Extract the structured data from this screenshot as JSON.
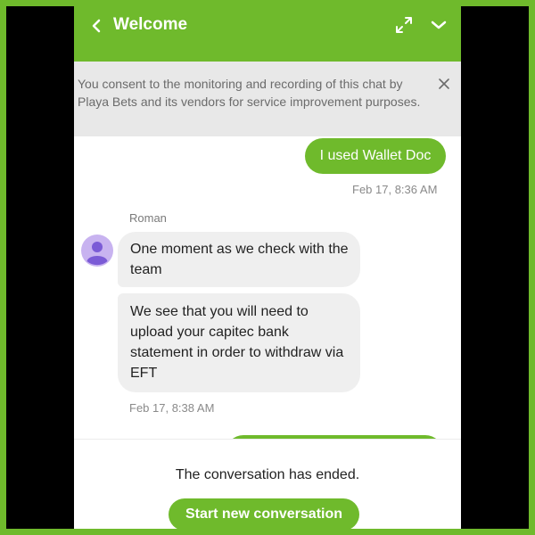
{
  "header": {
    "title": "Welcome",
    "background": "#6fba2c"
  },
  "consent": {
    "text": "You consent to the monitoring and recording of this chat by Playa Bets and its vendors for service improvement purposes."
  },
  "messages": [
    {
      "direction": "outgoing",
      "text": "I used Wallet Doc",
      "timestamp": "Feb 17, 8:36 AM"
    },
    {
      "direction": "incoming",
      "sender": "Roman",
      "texts": [
        "One moment as we check with the team",
        "We see that you will need to upload your capitec bank statement in order to withdraw via EFT"
      ],
      "timestamp": "Feb 17, 8:38 AM"
    }
  ],
  "footer": {
    "ended_text": "The conversation has ended.",
    "start_button_label": "Start new conversation"
  },
  "colors": {
    "accent": "#6fba2c",
    "incoming_bubble": "#efefef",
    "consent_bg": "#e8e8e8",
    "avatar": "#c8b3f0",
    "avatar_figure": "#7b5bd6"
  },
  "icons": {
    "back": "chevron-left-icon",
    "expand": "expand-arrows-icon",
    "collapse": "chevron-down-icon",
    "close": "close-icon",
    "avatar": "user-avatar-icon"
  }
}
